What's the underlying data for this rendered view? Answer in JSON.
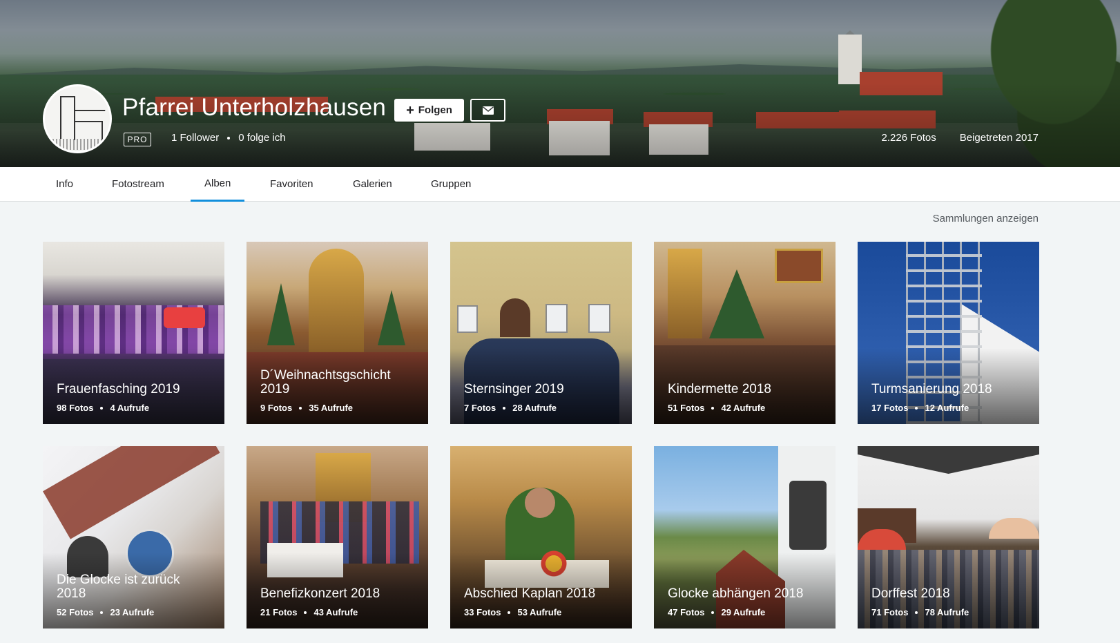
{
  "profile": {
    "name": "Pfarrei Unterholzhausen",
    "follow_label": "Folgen",
    "badge": "PRO",
    "followers": "1 Follower",
    "following": "0 folge ich",
    "photos": "2.226 Fotos",
    "joined": "Beigetreten 2017"
  },
  "nav": {
    "tabs": [
      {
        "label": "Info"
      },
      {
        "label": "Fotostream"
      },
      {
        "label": "Alben",
        "active": true
      },
      {
        "label": "Favoriten"
      },
      {
        "label": "Galerien"
      },
      {
        "label": "Gruppen"
      }
    ],
    "active_color": "#128fdc"
  },
  "collections_link": "Sammlungen anzeigen",
  "albums": [
    {
      "title": "Frauenfasching 2019",
      "photos": "98 Fotos",
      "views": "4 Aufrufe"
    },
    {
      "title": "D´Weihnachtsgschicht 2019",
      "photos": "9 Fotos",
      "views": "35 Aufrufe"
    },
    {
      "title": "Sternsinger 2019",
      "photos": "7 Fotos",
      "views": "28 Aufrufe"
    },
    {
      "title": "Kindermette 2018",
      "photos": "51 Fotos",
      "views": "42 Aufrufe"
    },
    {
      "title": "Turmsanierung 2018",
      "photos": "17 Fotos",
      "views": "12 Aufrufe"
    },
    {
      "title": "Die Glocke ist zurück 2018",
      "photos": "52 Fotos",
      "views": "23 Aufrufe"
    },
    {
      "title": "Benefizkonzert 2018",
      "photos": "21 Fotos",
      "views": "43 Aufrufe"
    },
    {
      "title": "Abschied Kaplan 2018",
      "photos": "33 Fotos",
      "views": "53 Aufrufe"
    },
    {
      "title": "Glocke abhängen 2018",
      "photos": "47 Fotos",
      "views": "29 Aufrufe"
    },
    {
      "title": "Dorffest 2018",
      "photos": "71 Fotos",
      "views": "78 Aufrufe"
    }
  ],
  "icons": {
    "follow": "plus-icon",
    "message": "mail-icon"
  }
}
